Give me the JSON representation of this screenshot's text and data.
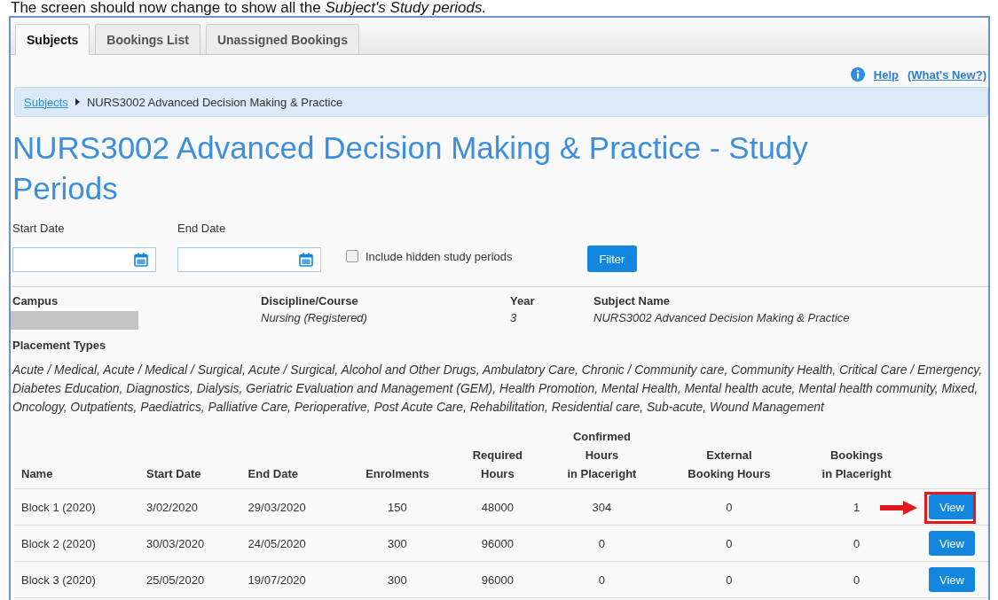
{
  "caption": "The screen should now change to show all the *Subject's Study periods.*",
  "tabs": [
    {
      "label": "Subjects",
      "selected": true
    },
    {
      "label": "Bookings List",
      "selected": false
    },
    {
      "label": "Unassigned Bookings",
      "selected": false
    }
  ],
  "help_links": [
    "Help",
    "(What's New?)"
  ],
  "breadcrumb": {
    "link": "Subjects",
    "current": "NURS3002 Advanced Decision Making & Practice"
  },
  "title": "NURS3002 Advanced Decision Making & Practice - Study Periods",
  "filters": {
    "start_label": "Start Date",
    "end_label": "End Date",
    "hidden_label": "Include hidden study periods",
    "hidden_checked": false,
    "button": "Filter"
  },
  "details": [
    {
      "label": "Campus",
      "kind": "redacted"
    },
    {
      "label": "Discipline/Course",
      "value": "Nursing (Registered)",
      "kind": "text"
    },
    {
      "label": "Year",
      "value": "3",
      "kind": "text"
    },
    {
      "label": "Subject Name",
      "value": "NURS3002 Advanced Decision Making & Practice",
      "kind": "text"
    }
  ],
  "placement_types": {
    "label": "Placement Types",
    "value": "Acute / Medical, Acute / Medical / Surgical, Acute / Surgical, Alcohol and Other Drugs, Ambulatory Care, Chronic / Community care, Community Health, Critical Care / Emergency, Diabetes Education, Diagnostics, Dialysis, Geriatric Evaluation and Management (GEM), Health Promotion, Mental Health, Mental health acute, Mental health community, Mixed, Oncology, Outpatients, Paediatrics, Palliative Care, Perioperative, Post Acute Care, Rehabilitation, Residential care, Sub-acute, Wound Management"
  },
  "table": {
    "columns": [
      "Name",
      "Start Date",
      "End Date",
      "Enrolments",
      "Required\nHours",
      "Confirmed\nHours\nin Placeright",
      "External\nBooking Hours",
      "Bookings\nin Placeright"
    ],
    "rows": [
      {
        "cells": [
          "Block 1 (2020)",
          "3/02/2020",
          "29/03/2020",
          "150",
          "48000",
          "304",
          "0",
          "1"
        ],
        "action": "View",
        "highlighted": true
      },
      {
        "cells": [
          "Block 2 (2020)",
          "30/03/2020",
          "24/05/2020",
          "300",
          "96000",
          "0",
          "0",
          "0"
        ],
        "action": "View",
        "highlighted": false
      },
      {
        "cells": [
          "Block 3 (2020)",
          "25/05/2020",
          "19/07/2020",
          "300",
          "96000",
          "0",
          "0",
          "0"
        ],
        "action": "View",
        "highlighted": false
      }
    ]
  }
}
